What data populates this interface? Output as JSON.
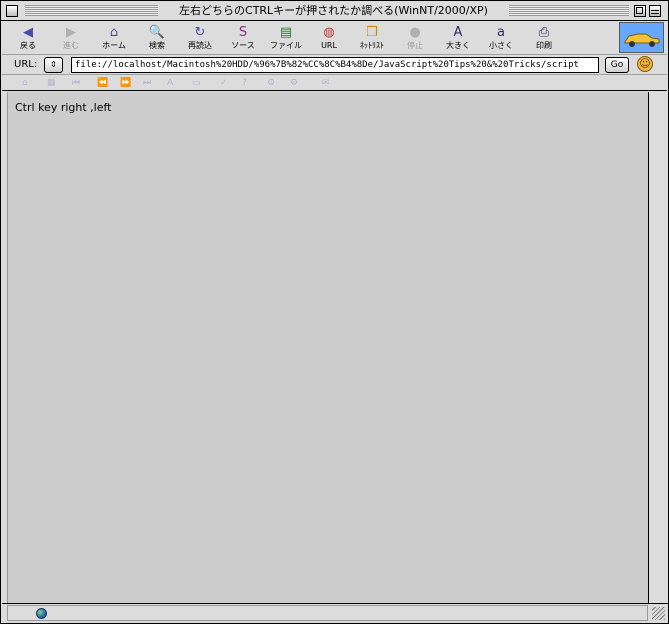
{
  "window": {
    "title": "左右どちらのCTRLキーが押されたか調べる(WinNT/2000/XP)"
  },
  "toolbar": {
    "items": [
      {
        "label": "戻る",
        "icon": "back-arrow-icon",
        "glyph": "◀",
        "color": "#4a4aa8",
        "enabled": true
      },
      {
        "label": "進む",
        "icon": "forward-arrow-icon",
        "glyph": "▶",
        "color": "#9a9a9a",
        "enabled": false
      },
      {
        "label": "ホーム",
        "icon": "home-icon",
        "glyph": "⌂",
        "color": "#4a4aa8",
        "enabled": true
      },
      {
        "label": "検索",
        "icon": "search-icon",
        "glyph": "🔍",
        "color": "#4a4aa8",
        "enabled": true
      },
      {
        "label": "再読込",
        "icon": "reload-icon",
        "glyph": "↻",
        "color": "#4a4aa8",
        "enabled": true
      },
      {
        "label": "ソース",
        "icon": "source-icon",
        "glyph": "S",
        "color": "#8a2a8a",
        "enabled": true
      },
      {
        "label": "ファイル",
        "icon": "file-icon",
        "glyph": "▤",
        "color": "#2a7a2a",
        "enabled": true
      },
      {
        "label": "URL",
        "icon": "globe-icon",
        "glyph": "◍",
        "color": "#c0392b",
        "enabled": true
      },
      {
        "label": "ﾈｯﾄﾘｽﾄ",
        "icon": "netlist-icon",
        "glyph": "❒",
        "color": "#d08a00",
        "enabled": true
      },
      {
        "label": "停止",
        "icon": "stop-icon",
        "glyph": "●",
        "color": "#c08a7a",
        "enabled": false
      },
      {
        "label": "大きく",
        "icon": "font-larger-icon",
        "glyph": "A",
        "color": "#2a2a6a",
        "enabled": true
      },
      {
        "label": "小さく",
        "icon": "font-smaller-icon",
        "glyph": "a",
        "color": "#2a2a6a",
        "enabled": true
      },
      {
        "label": "印刷",
        "icon": "print-icon",
        "glyph": "⎙",
        "color": "#2a2a6a",
        "enabled": true
      }
    ]
  },
  "address": {
    "label": "URL:",
    "popup_glyph": "⇕",
    "value": "file://localhost/Macintosh%20HDD/%96%7B%82%CC%8C%B4%8De/JavaScript%20Tips%20&%20Tricks/script",
    "go_label": "Go",
    "smiley_glyph": "☺"
  },
  "content": {
    "text": "Ctrl key right ,left"
  }
}
